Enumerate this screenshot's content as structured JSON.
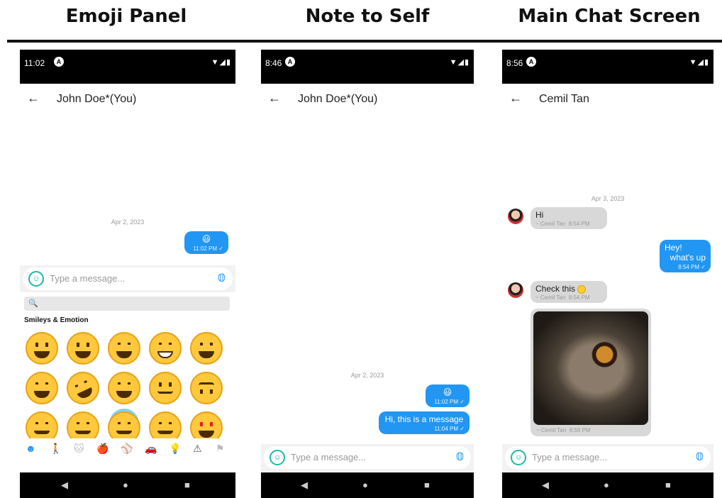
{
  "captions": {
    "panel1": "Emoji Panel",
    "panel2": "Note to Self",
    "panel3": "Main Chat Screen"
  },
  "phones": {
    "p1": {
      "time": "11:02",
      "chat_title": "John Doe*(You)",
      "date": "Apr 2, 2023",
      "messages": [
        {
          "text": "😃",
          "time": "11:02 PM",
          "tick": "✓"
        }
      ],
      "composer_placeholder": "Type a message...",
      "emoji_search": "🔍",
      "emoji_category": "Smileys & Emotion"
    },
    "p2": {
      "time": "8:46",
      "chat_title": "John Doe*(You)",
      "date": "Apr 2, 2023",
      "messages": [
        {
          "text": "😃",
          "time": "11:02 PM",
          "tick": "✓"
        },
        {
          "text": "Hi, this is a message",
          "time": "11:04 PM",
          "tick": "✓"
        }
      ],
      "composer_placeholder": "Type a message..."
    },
    "p3": {
      "time": "8:56",
      "chat_title": "Cemil Tan",
      "date": "Apr 3, 2023",
      "incoming1": {
        "text": "Hi",
        "sender": "~ Cemil Tan",
        "time": "8:54 PM"
      },
      "outgoing1": {
        "line1": "Hey!",
        "line2": "what's up",
        "time": "8:54 PM",
        "tick": "✓"
      },
      "incoming2": {
        "text": "Check this",
        "sender": "~ Cemil Tan",
        "time": "8:54 PM"
      },
      "image_caption": {
        "sender": "~ Cemil Tan",
        "time": "8:56 PM"
      },
      "composer_placeholder": "Type a message..."
    }
  },
  "icons": {
    "back": "←",
    "nav_back": "◀",
    "nav_home": "●",
    "nav_recent": "■",
    "clip": "⌀",
    "status_sys": "▼◢▮"
  },
  "colors": {
    "outgoing_bubble": "#2196f3",
    "incoming_bubble": "#d8d8d8",
    "accent_teal": "#1db9a6"
  }
}
